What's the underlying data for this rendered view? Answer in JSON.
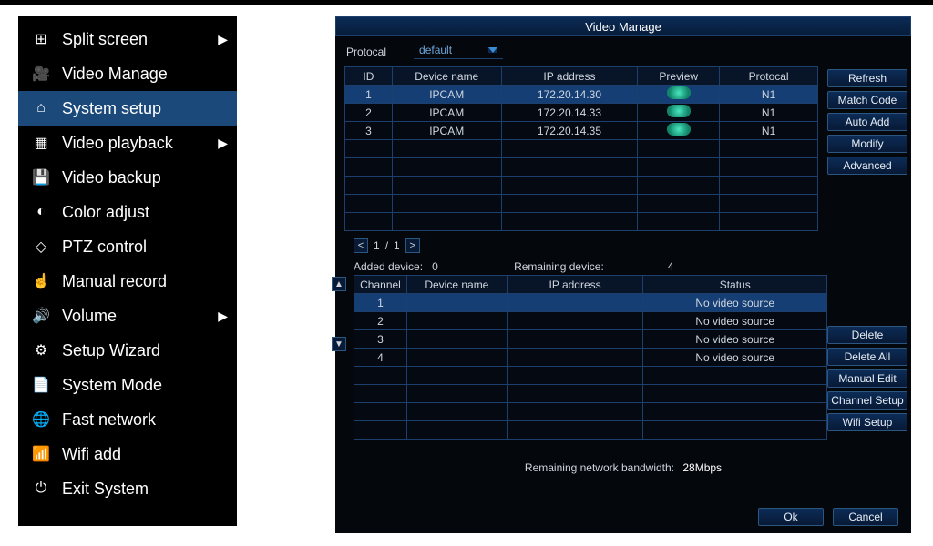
{
  "sidebar": {
    "items": [
      {
        "label": "Split screen",
        "icon": "⊞",
        "arrow": true
      },
      {
        "label": "Video Manage",
        "icon": "🎥"
      },
      {
        "label": "System setup",
        "icon": "⌂",
        "selected": true
      },
      {
        "label": "Video playback",
        "icon": "▦",
        "arrow": true
      },
      {
        "label": "Video backup",
        "icon": "💾"
      },
      {
        "label": "Color adjust",
        "icon": "◐"
      },
      {
        "label": "PTZ control",
        "icon": "◇"
      },
      {
        "label": "Manual record",
        "icon": "☝"
      },
      {
        "label": "Volume",
        "icon": "🔊",
        "arrow": true
      },
      {
        "label": "Setup Wizard",
        "icon": "⚙"
      },
      {
        "label": "System Mode",
        "icon": "📄"
      },
      {
        "label": "Fast network",
        "icon": "🌐"
      },
      {
        "label": "Wifi add",
        "icon": "📶"
      },
      {
        "label": "Exit System",
        "icon": "⏻"
      }
    ]
  },
  "dialog": {
    "title": "Video Manage",
    "protocol_label": "Protocal",
    "protocol_value": "default",
    "top_table": {
      "headers": [
        "ID",
        "Device name",
        "IP address",
        "Preview",
        "Protocal"
      ],
      "rows": [
        {
          "id": "1",
          "name": "IPCAM",
          "ip": "172.20.14.30",
          "proto": "N1",
          "selected": true
        },
        {
          "id": "2",
          "name": "IPCAM",
          "ip": "172.20.14.33",
          "proto": "N1"
        },
        {
          "id": "3",
          "name": "IPCAM",
          "ip": "172.20.14.35",
          "proto": "N1"
        }
      ]
    },
    "pager": {
      "page": "1",
      "sep": "/",
      "total": "1"
    },
    "right_buttons_top": [
      "Refresh",
      "Match Code",
      "Auto Add",
      "Modify",
      "Advanced"
    ],
    "added_label": "Added device:",
    "added_count": "0",
    "remaining_label": "Remaining device:",
    "remaining_count": "4",
    "bottom_table": {
      "headers": [
        "Channel",
        "Device name",
        "IP address",
        "Status"
      ],
      "rows": [
        {
          "ch": "1",
          "name": "",
          "ip": "",
          "status": "No video source",
          "selected": true
        },
        {
          "ch": "2",
          "name": "",
          "ip": "",
          "status": "No video source"
        },
        {
          "ch": "3",
          "name": "",
          "ip": "",
          "status": "No video source"
        },
        {
          "ch": "4",
          "name": "",
          "ip": "",
          "status": "No video source"
        }
      ]
    },
    "right_buttons_bottom": [
      "Delete",
      "Delete All",
      "Manual Edit",
      "Channel Setup",
      "Wifi Setup"
    ],
    "bandwidth_label": "Remaining network bandwidth:",
    "bandwidth_value": "28Mbps",
    "ok": "Ok",
    "cancel": "Cancel"
  }
}
